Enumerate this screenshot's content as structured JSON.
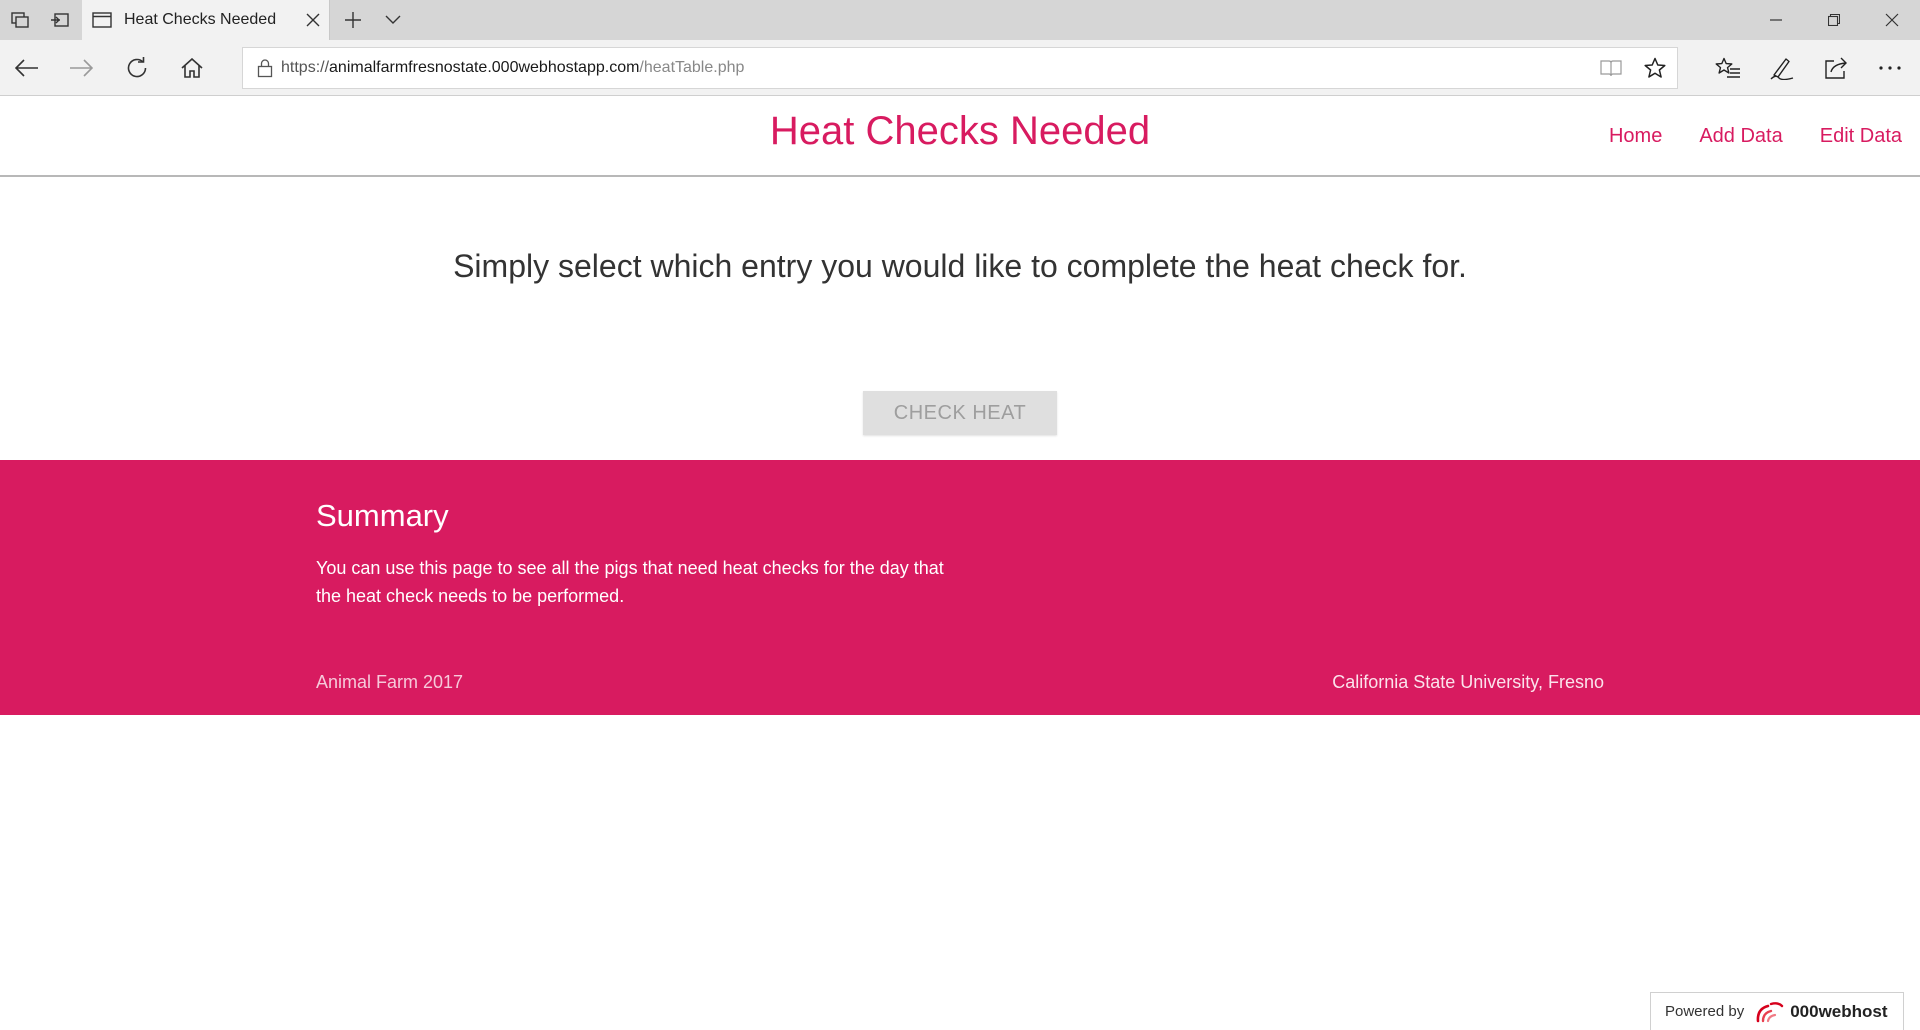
{
  "browser": {
    "tab_title": "Heat Checks Needed",
    "url_scheme": "https://",
    "url_host": "animalfarmfresnostate.000webhostapp.com",
    "url_path": "/heatTable.php"
  },
  "header": {
    "title": "Heat Checks Needed",
    "nav": [
      {
        "label": "Home"
      },
      {
        "label": "Add Data"
      },
      {
        "label": "Edit Data"
      }
    ]
  },
  "main": {
    "instructions": "Simply select which entry you would like to complete the heat check for.",
    "button_label": "CHECK HEAT"
  },
  "footer": {
    "heading": "Summary",
    "text": "You can use this page to see all the pigs that need heat checks for the day that the heat check needs to be performed.",
    "copyright": "Animal Farm 2017",
    "university": "California State University, Fresno"
  },
  "badge": {
    "label": "Powered by",
    "brand": "000webhost"
  },
  "colors": {
    "accent": "#d81b60",
    "button_bg": "#dfdfdf",
    "button_text": "#9e9e9e"
  }
}
